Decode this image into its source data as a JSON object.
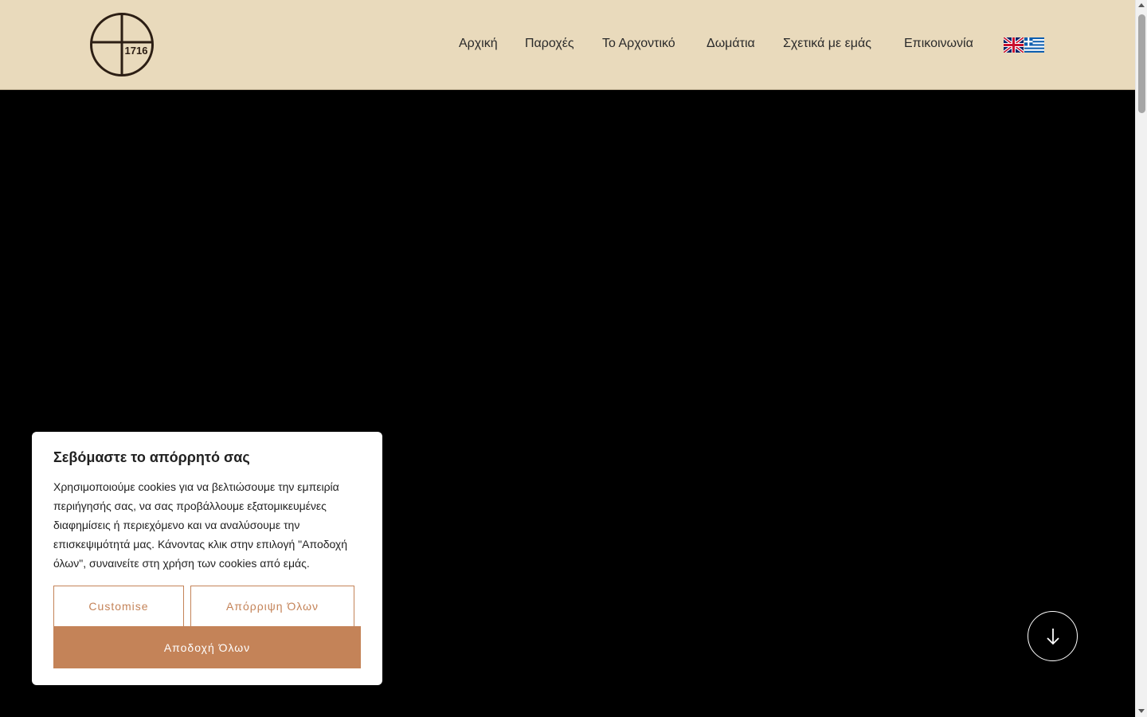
{
  "header": {
    "logo": {
      "year": "1716"
    },
    "nav": [
      {
        "label": "Αρχική"
      },
      {
        "label": "Παροχές"
      },
      {
        "label": "Το Αρχοντικό"
      },
      {
        "label": "Δωμάτια"
      },
      {
        "label": "Σχετικά με εμάς"
      },
      {
        "label": "Επικοινωνία"
      }
    ],
    "languages": [
      "English",
      "Greek"
    ]
  },
  "hero": {
    "scroll_icon": "arrow-down-icon"
  },
  "cookie_banner": {
    "title": "Σεβόμαστε το απόρρητό σας",
    "text": "Χρησιμοποιούμε cookies για να βελτιώσουμε την εμπειρία περιήγησής σας, να σας προβάλλουμε εξατομικευμένες διαφημίσεις ή περιεχόμενο και να αναλύσουμε την επισκεψιμότητά μας. Κάνοντας κλικ στην επιλογή \"Αποδοχή όλων\", συναινείτε στη χρήση των cookies από εμάς.",
    "customise_label": "Customise",
    "reject_label": "Απόρριψη Όλων",
    "accept_label": "Αποδοχή Όλων"
  },
  "colors": {
    "header_bg": "#e9dabc",
    "accent": "#c48358",
    "hero_bg": "#000000"
  }
}
